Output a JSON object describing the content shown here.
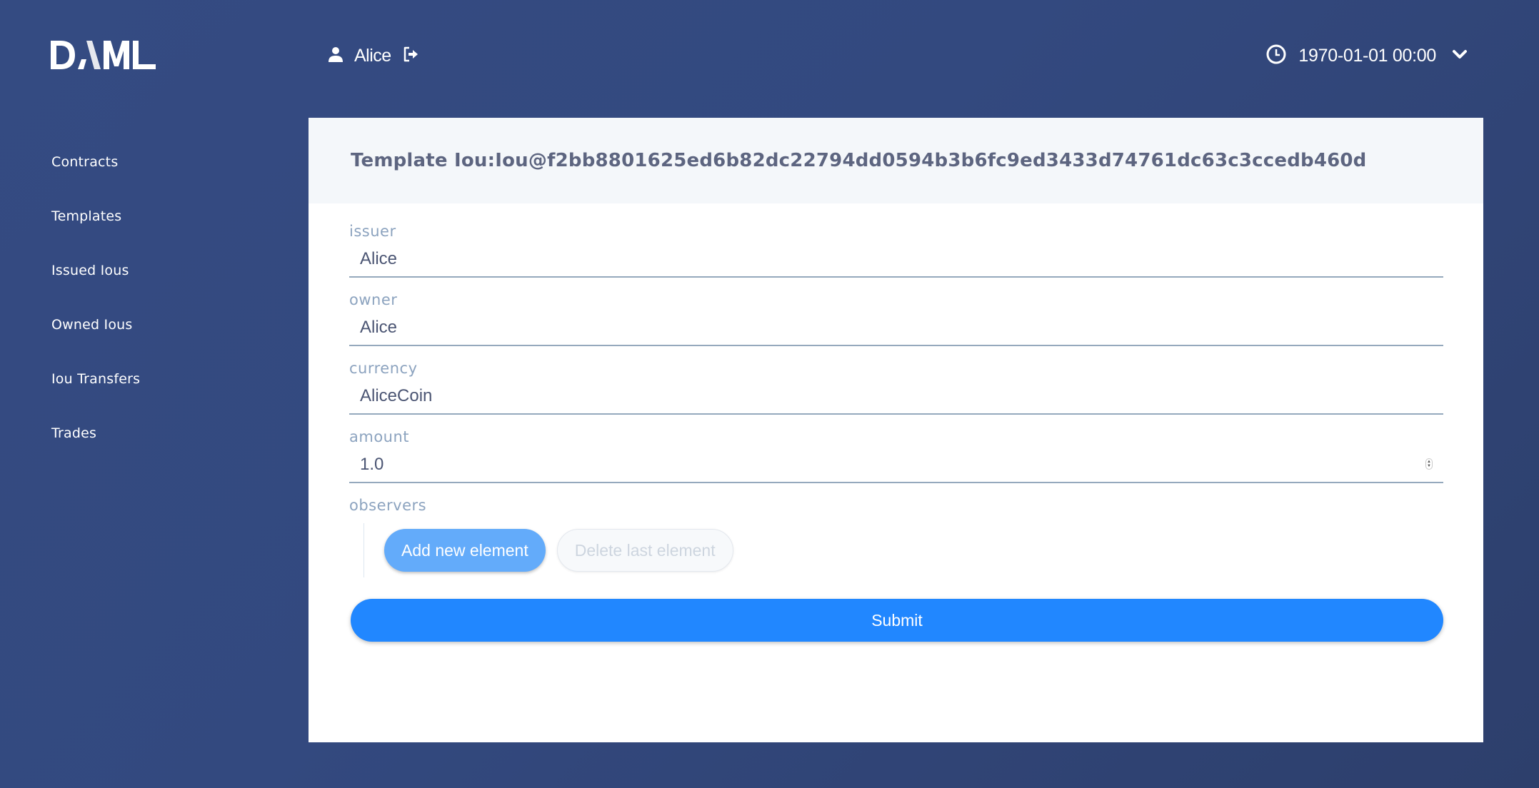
{
  "app": {
    "logo_text": "DAML"
  },
  "header": {
    "user": {
      "icon": "user-icon",
      "name": "Alice",
      "logout_icon": "sign-out-icon"
    },
    "time": {
      "icon": "clock-icon",
      "value": "1970-01-01 00:00",
      "dropdown_icon": "chevron-down-icon"
    }
  },
  "sidebar": {
    "items": [
      {
        "label": "Contracts"
      },
      {
        "label": "Templates"
      },
      {
        "label": "Issued Ious"
      },
      {
        "label": "Owned Ious"
      },
      {
        "label": "Iou Transfers"
      },
      {
        "label": "Trades"
      }
    ]
  },
  "card": {
    "title": "Template Iou:Iou@f2bb8801625ed6b82dc22794dd0594b3b6fc9ed3433d74761dc63c3ccedb460d",
    "fields": [
      {
        "label": "issuer",
        "value": "Alice"
      },
      {
        "label": "owner",
        "value": "Alice"
      },
      {
        "label": "currency",
        "value": "AliceCoin"
      },
      {
        "label": "amount",
        "value": "1.0"
      }
    ],
    "observers": {
      "label": "observers",
      "add_label": "Add new element",
      "delete_label": "Delete last element"
    },
    "submit_label": "Submit"
  },
  "colors": {
    "background": "#33497f",
    "primary": "#2187ff",
    "secondary": "#63abfa",
    "label": "#8ca3bf",
    "text": "#4b5573"
  }
}
